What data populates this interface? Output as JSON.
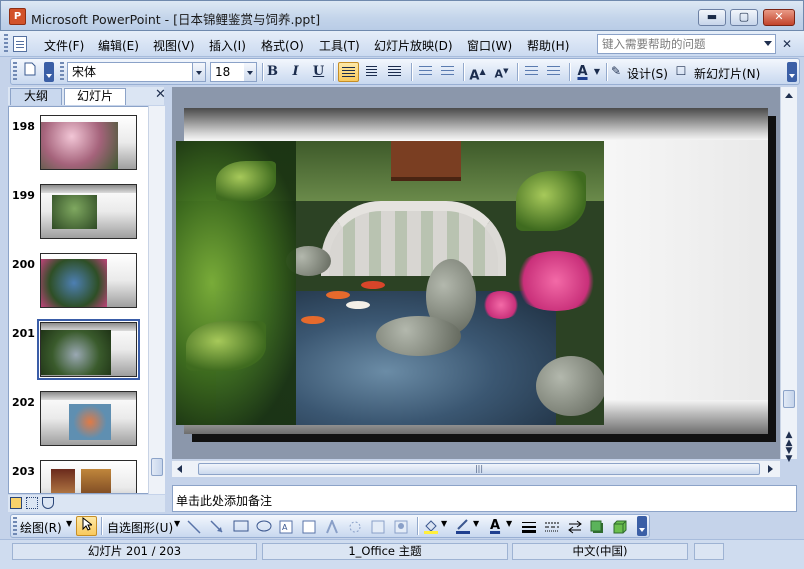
{
  "titlebar": {
    "app_icon": "powerpoint-icon",
    "title": "Microsoft PowerPoint - [日本锦鲤鉴赏与饲养.ppt]",
    "minimize_label": "▬",
    "maximize_label": "▢",
    "close_label": "✕"
  },
  "menubar": {
    "items": [
      "文件(F)",
      "编辑(E)",
      "视图(V)",
      "插入(I)",
      "格式(O)",
      "工具(T)",
      "幻灯片放映(D)",
      "窗口(W)",
      "帮助(H)"
    ],
    "help_placeholder": "键入需要帮助的问题",
    "doc_close_label": "✕"
  },
  "format_toolbar": {
    "font_name": "宋体",
    "font_size": "18",
    "bold_label": "B",
    "italic_label": "I",
    "underline_label": "U",
    "increase_font_label": "A",
    "decrease_font_label": "A",
    "font_color_label": "A",
    "design_label": "设计(S)",
    "new_slide_label": "新幻灯片(N)"
  },
  "left_pane": {
    "tabs": [
      "大纲",
      "幻灯片"
    ],
    "selected_tab": "幻灯片",
    "close_label": "✕",
    "slides": [
      {
        "number": "198",
        "selected": false
      },
      {
        "number": "199",
        "selected": false
      },
      {
        "number": "200",
        "selected": false
      },
      {
        "number": "201",
        "selected": true
      },
      {
        "number": "202",
        "selected": false
      },
      {
        "number": "203",
        "selected": false
      }
    ]
  },
  "main": {
    "notes_placeholder": "单击此处添加备注",
    "hscroll_grip": "|||"
  },
  "draw_toolbar": {
    "draw_label": "绘图(R)",
    "autoshapes_label": "自选图形(U)"
  },
  "statusbar": {
    "slide_position": "幻灯片 201 / 203",
    "theme": "1_Office 主题",
    "language": "中文(中国)"
  },
  "colors": {
    "accent": "#3a5da8",
    "toolbar_highlight": "#f9c95d",
    "font_color_bar": "#1f3f8f",
    "highlight_color_bar": "#ffef3c"
  }
}
